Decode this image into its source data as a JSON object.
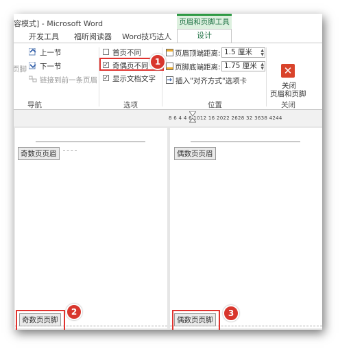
{
  "window": {
    "title": "容模式] - Microsoft Word",
    "context_tab": "页眉和页脚工具"
  },
  "tabs": [
    {
      "label": "开发工具"
    },
    {
      "label": "福昕阅读器"
    },
    {
      "label": "Word技巧达人"
    },
    {
      "label": "设计",
      "active": true
    }
  ],
  "ribbon": {
    "nav": {
      "prev_section": "上一节",
      "next_section": "下一节",
      "link_previous": "链接到前一条页眉",
      "footer_partial": "页脚",
      "group_label": "导航"
    },
    "options": {
      "first_page_diff": {
        "label": "首页不同",
        "checked": false
      },
      "odd_even_diff": {
        "label": "奇偶页不同",
        "checked": true
      },
      "show_doc_text": {
        "label": "显示文档文字",
        "checked": true
      },
      "group_label": "选项"
    },
    "position": {
      "header_top_label": "页眉顶端距离:",
      "header_top_value": "1.5 厘米",
      "footer_bottom_label": "页脚底端距离:",
      "footer_bottom_value": "1.75 厘米",
      "insert_align_tab": "插入\"对齐方式\"选项卡",
      "group_label": "位置"
    },
    "close": {
      "line1": "关闭",
      "line2": "页眉和页脚",
      "group_label": "关闭",
      "icon": "close-x-icon"
    }
  },
  "ruler": {
    "text": "8 6 4    4 6  1012  16  2022  2628  32  3638 4244"
  },
  "pages": {
    "odd": {
      "header_label": "奇数页页眉",
      "footer_label": "奇数页页脚"
    },
    "even": {
      "header_label": "偶数页页眉",
      "footer_label": "偶数页页脚"
    }
  },
  "callouts": [
    "1",
    "2",
    "3"
  ],
  "colors": {
    "accent": "#217346",
    "callout": "#d8362d",
    "close": "#d9432b"
  }
}
